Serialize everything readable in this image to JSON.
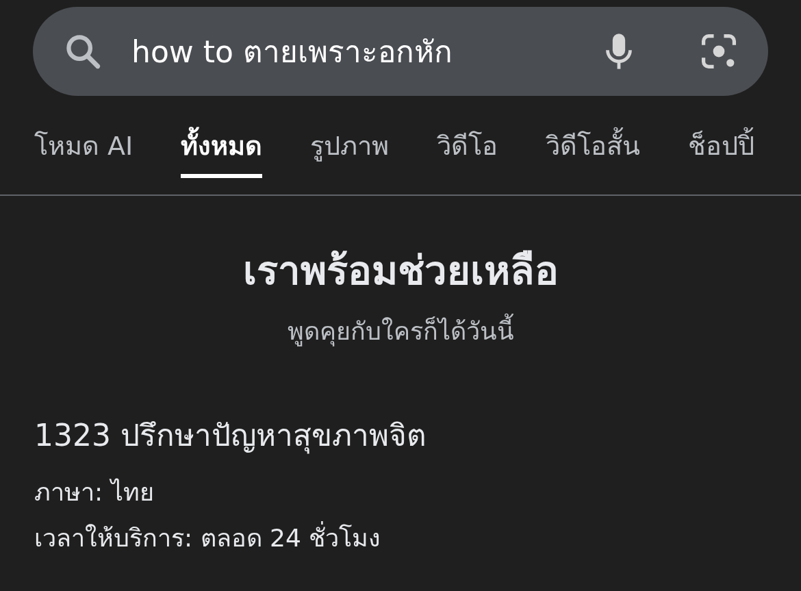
{
  "search": {
    "value": "how to ตายเพราะอกหัก"
  },
  "tabs": [
    {
      "label": "โหมด AI",
      "selected": false
    },
    {
      "label": "ทั้งหมด",
      "selected": true
    },
    {
      "label": "รูปภาพ",
      "selected": false
    },
    {
      "label": "วิดีโอ",
      "selected": false
    },
    {
      "label": "วิดีโอสั้น",
      "selected": false
    },
    {
      "label": "ช็อปปิ้",
      "selected": false
    }
  ],
  "help": {
    "title": "เราพร้อมช่วยเหลือ",
    "subtitle": "พูดคุยกับใครก็ได้วันนี้",
    "hotline": "1323 ปรึกษาปัญหาสุขภาพจิต",
    "details": [
      "ภาษา: ไทย",
      "เวลาให้บริการ: ตลอด 24 ชั่วโมง"
    ]
  }
}
